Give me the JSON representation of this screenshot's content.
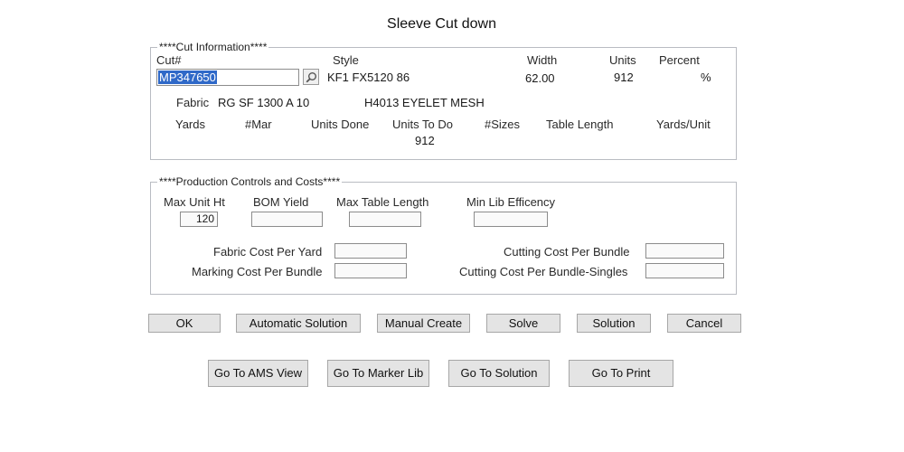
{
  "window": {
    "title": "Sleeve Cut down"
  },
  "cut_info": {
    "legend": "****Cut Information****",
    "labels": {
      "cut": "Cut#",
      "style": "Style",
      "width": "Width",
      "units": "Units",
      "percent": "Percent"
    },
    "cut_value": "MP347650",
    "style_value": "KF1 FX5120 86",
    "width_value": "62.00",
    "units_value": "912",
    "percent_value": "%",
    "fabric_label": "Fabric",
    "fabric_code": "RG SF 1300 A 10",
    "fabric_desc": "H4013 EYELET MESH",
    "columns": [
      "Yards",
      "#Mar",
      "Units Done",
      "Units To Do",
      "#Sizes",
      "Table Length",
      "Yards/Unit"
    ],
    "units_to_do_value": "912"
  },
  "production": {
    "legend": "****Production Controls and Costs****",
    "max_unit_ht_label": "Max Unit Ht",
    "max_unit_ht_value": "120",
    "bom_yield_label": "BOM Yield",
    "max_table_length_label": "Max Table Length",
    "min_lib_efficiency_label": "Min Lib Efficency",
    "fabric_cost_label": "Fabric Cost Per Yard",
    "marking_cost_label": "Marking Cost Per Bundle",
    "cutting_cost_label": "Cutting Cost Per Bundle",
    "cutting_cost_singles_label": "Cutting Cost Per Bundle-Singles"
  },
  "buttons": {
    "ok": "OK",
    "automatic_solution": "Automatic Solution",
    "manual_create": "Manual Create",
    "solve": "Solve",
    "solution": "Solution",
    "cancel": "Cancel",
    "go_to_ams_view": "Go To AMS View",
    "go_to_marker_lib": "Go To Marker Lib",
    "go_to_solution": "Go To Solution",
    "go_to_print": "Go To Print"
  }
}
